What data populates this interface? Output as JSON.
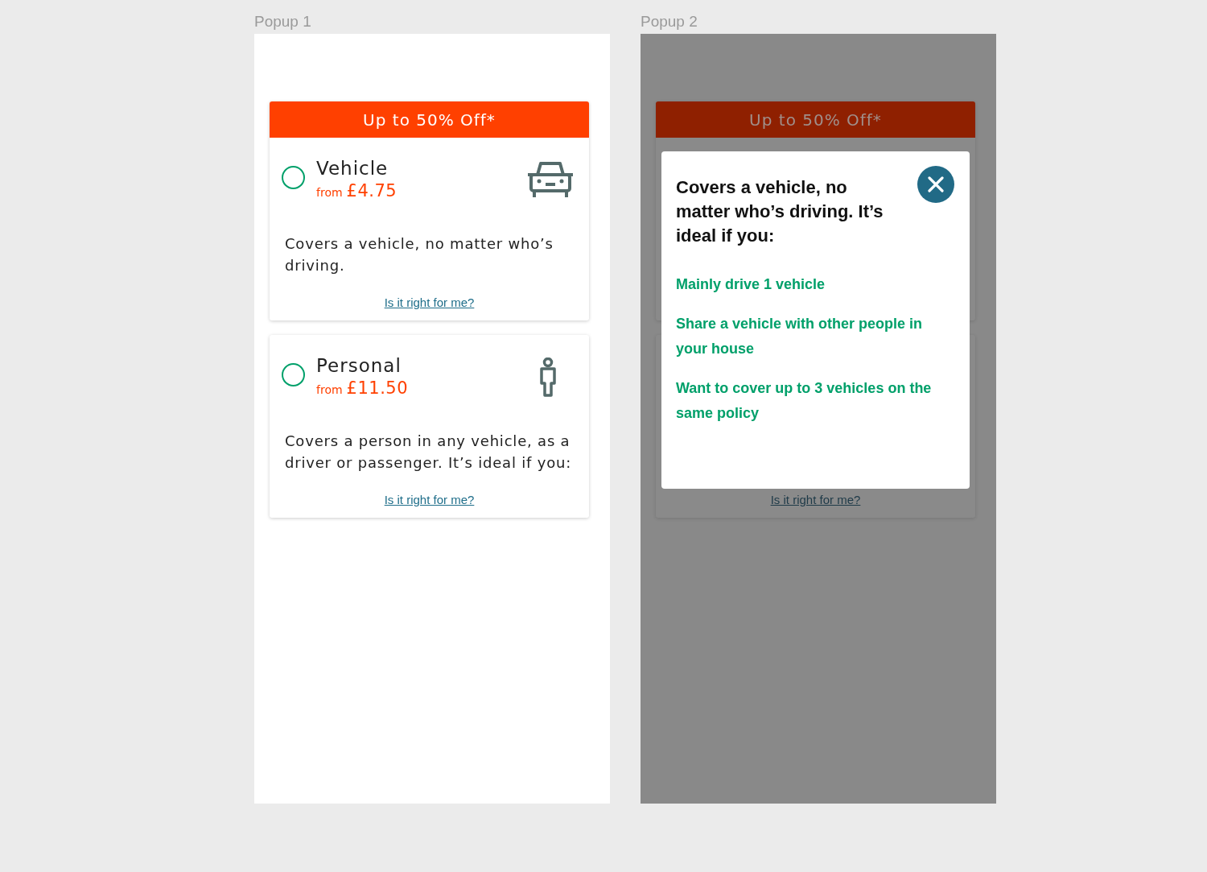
{
  "frames": [
    {
      "label": "Popup 1",
      "kind": "list",
      "banner": "Up to 50% Off*",
      "options": [
        {
          "kind": "vehicle",
          "title": "Vehicle",
          "from": "from",
          "price": "£4.75",
          "selected": false,
          "description": "Covers a vehicle, no matter who’s driving.",
          "link": "Is it right for me?"
        },
        {
          "kind": "person",
          "title": "Personal",
          "from": "from",
          "price": "£11.50",
          "selected": false,
          "description": "Covers a person in any vehicle, as a driver or passenger. It’s ideal if you:",
          "link": "Is it right for me?"
        }
      ]
    },
    {
      "label": "Popup 2",
      "kind": "modal",
      "banner": "Up to 50% Off*",
      "link": "Is it right for me?",
      "modal": {
        "title": "Covers a vehicle, no matter who’s driving. It’s ideal if you:",
        "items": [
          "Mainly drive 1 vehicle",
          "Share a vehicle with other people in your house",
          "Want to cover up to 3 vehicles on the same policy"
        ]
      }
    }
  ]
}
